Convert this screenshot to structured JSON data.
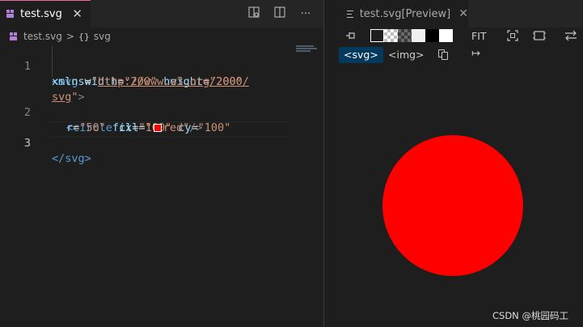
{
  "editor": {
    "tab": {
      "label": "test.svg",
      "close_icon": "close-icon"
    },
    "actions": [
      "open-preview-icon",
      "split-editor-icon",
      "more-actions-icon"
    ],
    "breadcrumb": {
      "file": "test.svg",
      "separator": ">",
      "symbol": "{}",
      "node": "svg"
    },
    "lines": {
      "n1": "1",
      "n2": "2",
      "n3": "3",
      "l1a_open": "<svg",
      "l1a_attr1": " width",
      "l1a_eq1": "=",
      "l1a_val1": "\"200\"",
      "l1a_attr2": " height",
      "l1a_eq2": "=",
      "l1a_val2": "\"200\"",
      "l1b_attr": "xmlns",
      "l1b_eq": "=",
      "l1b_q1": "\"",
      "l1b_url": "http://www.w3.org/2000/",
      "l1c_url": "svg",
      "l1c_q2": "\"",
      "l1c_close": ">",
      "l2a_open": "<circle",
      "l2a_attr1": " cx",
      "l2a_eq1": "=",
      "l2a_val1": "\"100\"",
      "l2a_attr2": " cy",
      "l2a_eq2": "=",
      "l2a_val2": "\"100\"",
      "l2b_attr1": "r",
      "l2b_eq1": "=",
      "l2b_val1": "\"50\"",
      "l2b_attr2": " fill",
      "l2b_eq2": "=",
      "l2b_q1": "\"",
      "l2b_val2": "red\"",
      "l2b_close": "/>",
      "l3_close": "</svg>",
      "l3_gt": ">"
    }
  },
  "preview": {
    "tab": {
      "label": "test.svg[Preview]",
      "close_icon": "close-icon"
    },
    "toolbar": {
      "fit_label": "FIT",
      "icons": [
        "pin-icon",
        "zoom-fit-icon",
        "zoom-actual-icon",
        "swap-icon"
      ],
      "backgrounds": [
        "dark",
        "checker-light",
        "checker-dark",
        "light",
        "black",
        "white"
      ]
    },
    "modes": {
      "svg": "<svg>",
      "img": "<img>"
    },
    "shape": {
      "type": "circle",
      "fill": "#ff0000"
    }
  },
  "watermark": "CSDN @桃园码工",
  "colors": {
    "accent_tab": "#e06c9f",
    "selected_mode": "#04395e",
    "circle_fill": "#ff0000"
  }
}
